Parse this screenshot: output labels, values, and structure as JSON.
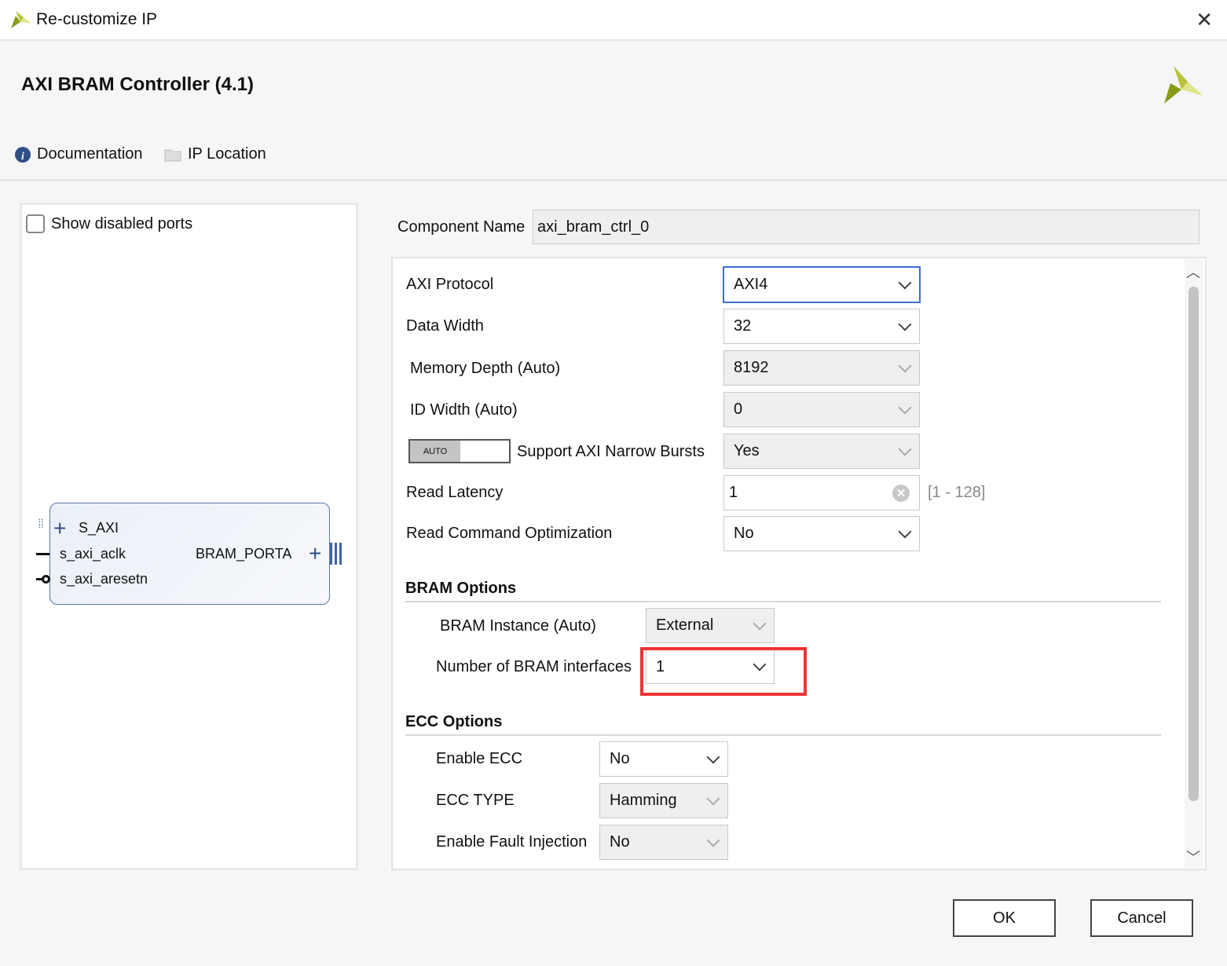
{
  "window": {
    "title": "Re-customize IP",
    "close_icon": "close-icon"
  },
  "header": {
    "title": "AXI BRAM Controller (4.1)",
    "documentation": "Documentation",
    "ip_location": "IP Location"
  },
  "left": {
    "show_disabled_ports": "Show disabled ports",
    "show_disabled_checked": false,
    "block": {
      "s_axi": "S_AXI",
      "aclk": "s_axi_aclk",
      "aresetn": "s_axi_aresetn",
      "bram_porta": "BRAM_PORTA"
    }
  },
  "component": {
    "label": "Component Name",
    "value": "axi_bram_ctrl_0"
  },
  "params": {
    "axi_protocol": {
      "label": "AXI Protocol",
      "value": "AXI4"
    },
    "data_width": {
      "label": "Data Width",
      "value": "32"
    },
    "memory_depth": {
      "label": "Memory Depth (Auto)",
      "value": "8192"
    },
    "id_width": {
      "label": "ID Width (Auto)",
      "value": "0"
    },
    "narrow_bursts": {
      "auto_label": "AUTO",
      "label": "Support AXI Narrow Bursts",
      "value": "Yes"
    },
    "read_latency": {
      "label": "Read Latency",
      "value": "1",
      "range": "[1 - 128]"
    },
    "read_cmd_opt": {
      "label": "Read Command Optimization",
      "value": "No"
    }
  },
  "bram": {
    "title": "BRAM Options",
    "instance": {
      "label": "BRAM Instance (Auto)",
      "value": "External"
    },
    "num_interfaces": {
      "label": "Number of BRAM interfaces",
      "value": "1"
    },
    "highlight_color": "#ee3333"
  },
  "ecc": {
    "title": "ECC Options",
    "enable": {
      "label": "Enable ECC",
      "value": "No"
    },
    "type": {
      "label": "ECC TYPE",
      "value": "Hamming"
    },
    "fault": {
      "label": "Enable Fault Injection",
      "value": "No"
    }
  },
  "buttons": {
    "ok": "OK",
    "cancel": "Cancel"
  }
}
